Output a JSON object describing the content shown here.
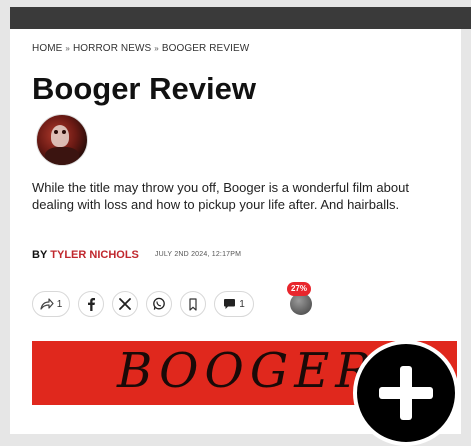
{
  "breadcrumb": {
    "home": "HOME",
    "section": "HORROR NEWS",
    "current": "BOOGER REVIEW",
    "separator": "»"
  },
  "article": {
    "title": "Booger Review",
    "excerpt": "While the title may throw you off, Booger is a wonderful film about dealing with loss and how to pickup your life after. And hairballs.",
    "byline_prefix": "BY",
    "author": "TYLER NICHOLS",
    "date": "JULY 2ND 2024, 12:17PM"
  },
  "actions": {
    "share_count": "1",
    "comment_count": "1",
    "reaction_badge": "27%"
  },
  "banner": {
    "text": "BOOGER"
  },
  "icons": {
    "share": "share-icon",
    "facebook": "facebook-icon",
    "x": "x-icon",
    "whatsapp": "whatsapp-icon",
    "bookmark": "bookmark-icon",
    "comment": "comment-icon",
    "plus": "plus-icon"
  },
  "colors": {
    "accent": "#c0272d",
    "banner": "#e0281d",
    "badge": "#e8262d"
  }
}
